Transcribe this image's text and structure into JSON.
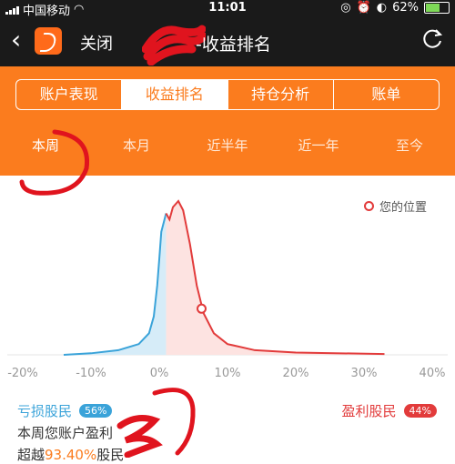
{
  "status": {
    "carrier": "中国移动",
    "time": "11:01",
    "battery": "62%",
    "battery_level": 0.62
  },
  "nav": {
    "close_label": "关闭",
    "title_visible": "-收益排名"
  },
  "tabs": [
    "账户表现",
    "收益排名",
    "持仓分析",
    "账单"
  ],
  "active_tab": 1,
  "periods": [
    "本周",
    "本月",
    "近半年",
    "近一年",
    "至今"
  ],
  "active_period": 0,
  "legend": {
    "label": "您的位置"
  },
  "chart_data": {
    "type": "area",
    "x_ticks": [
      "-20%",
      "-10%",
      "0%",
      "10%",
      "20%",
      "30%",
      "40%"
    ],
    "xlim": [
      -20,
      40
    ],
    "series": [
      {
        "name": "亏损股民",
        "color": "#3aa3d9",
        "x": [
          -14,
          -10,
          -6,
          -3,
          -1.5,
          -0.8,
          -0.3,
          0,
          0.3,
          1
        ],
        "y": [
          0,
          0.01,
          0.03,
          0.07,
          0.14,
          0.25,
          0.45,
          0.62,
          0.8,
          0.92
        ]
      },
      {
        "name": "盈利股民",
        "color": "#e23b3b",
        "x": [
          1,
          1.5,
          2,
          2.8,
          3.5,
          4.5,
          5.5,
          6.5,
          8,
          10,
          14,
          20,
          33
        ],
        "y": [
          0.92,
          0.88,
          0.96,
          1.0,
          0.94,
          0.72,
          0.45,
          0.27,
          0.14,
          0.07,
          0.03,
          0.015,
          0.005
        ]
      }
    ],
    "marker": {
      "x": 6.2,
      "y": 0.3
    }
  },
  "bottom": {
    "loss_label": "亏损股民",
    "loss_pct": "56%",
    "profit_label": "盈利股民",
    "profit_pct": "44%",
    "line1": "本周您账户盈利",
    "line2_prefix": "超越",
    "line2_pct": "93.40%",
    "line2_suffix": "股民"
  }
}
